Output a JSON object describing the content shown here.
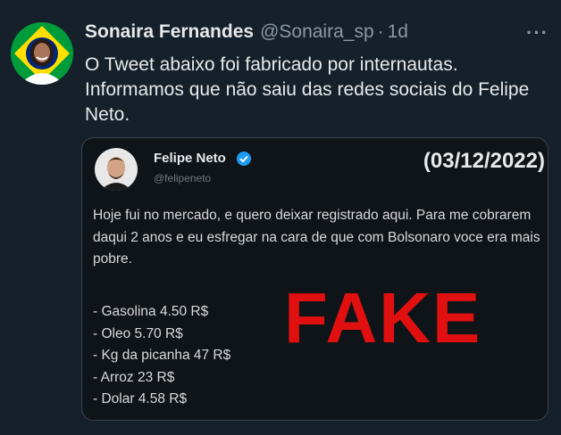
{
  "tweet": {
    "author_name": "Sonaira Fernandes",
    "author_handle": "@Sonaira_sp",
    "separator": "·",
    "time": "1d",
    "more_label": "···",
    "text": "O Tweet abaixo foi fabricado por internautas. Informamos que não saiu das redes sociais do Felipe Neto."
  },
  "quoted": {
    "author_name": "Felipe Neto",
    "author_handle": "@felipeneto",
    "date_overlay": "(03/12/2022)",
    "text": "Hoje fui no mercado, e quero deixar registrado aqui. Para me cobrarem daqui 2 anos e eu esfregar na cara de que com Bolsonaro voce era mais pobre.",
    "items": [
      "- Gasolina 4.50 R$",
      "- Oleo 5.70 R$",
      "- Kg da picanha 47 R$",
      "- Arroz 23 R$",
      "- Dolar 4.58 R$"
    ],
    "stamp": "FAKE"
  },
  "colors": {
    "background": "#15202b",
    "verified": "#1d9bf0",
    "stamp": "#e01010",
    "flag_green": "#009c3b",
    "flag_yellow": "#ffdf00",
    "flag_blue": "#002776"
  },
  "icons": {
    "verified": "verified-badge-icon",
    "more": "more-options-icon"
  }
}
